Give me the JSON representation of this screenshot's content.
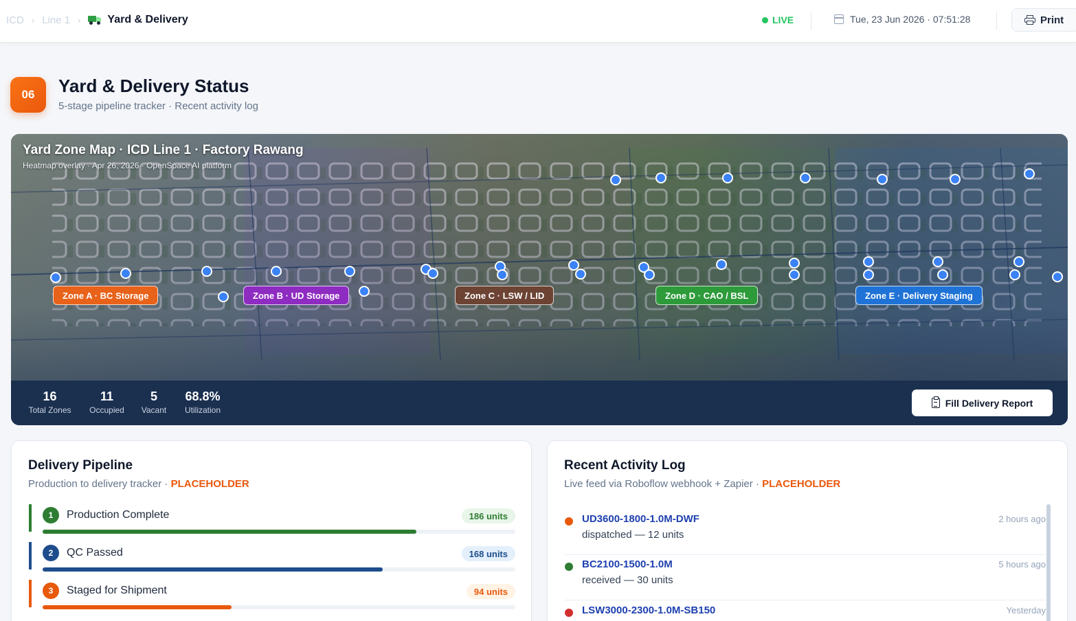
{
  "breadcrumb": {
    "items": [
      "ICD",
      "Line 1"
    ],
    "current": "Yard & Delivery"
  },
  "status": {
    "live_label": "LIVE",
    "datetime": "Tue, 23 Jun 2026 · 07:51:28",
    "print_label": "Print"
  },
  "section": {
    "badge": "06",
    "title": "Yard & Delivery Status",
    "subtitle": "5-stage pipeline tracker · Recent activity log"
  },
  "map": {
    "title": "Yard Zone Map · ICD Line 1 · Factory Rawang",
    "subtitle": "Heatmap overlay · Apr 26, 2026 · OpenSpace AI platform",
    "zones": [
      {
        "label": "Zone A · BC Storage",
        "color": "#e8621a"
      },
      {
        "label": "Zone B · UD Storage",
        "color": "#8e2bc1"
      },
      {
        "label": "Zone C · LSW / LID",
        "color": "#6d4434"
      },
      {
        "label": "Zone D · CAO / BSL",
        "color": "#2e9b3b"
      },
      {
        "label": "Zone E · Delivery Staging",
        "color": "#1f73d6"
      }
    ],
    "stats": [
      {
        "value": "16",
        "label": "Total Zones"
      },
      {
        "value": "11",
        "label": "Occupied"
      },
      {
        "value": "5",
        "label": "Vacant"
      },
      {
        "value": "68.8%",
        "label": "Utilization"
      }
    ],
    "fill_button": "Fill Delivery Report"
  },
  "pipeline": {
    "title": "Delivery Pipeline",
    "subtitle": "Production to delivery tracker · ",
    "placeholder": "PLACEHOLDER",
    "stages": [
      {
        "num": "1",
        "name": "Production Complete",
        "units": "186 units",
        "color": "#2e7d32",
        "bg": "#e8f5e9",
        "progress": 0.79
      },
      {
        "num": "2",
        "name": "QC Passed",
        "units": "168 units",
        "color": "#1e4d8c",
        "bg": "#e3f0fb",
        "progress": 0.72
      },
      {
        "num": "3",
        "name": "Staged for Shipment",
        "units": "94 units",
        "color": "#e8590c",
        "bg": "#fff3e6",
        "progress": 0.4
      }
    ]
  },
  "activity": {
    "title": "Recent Activity Log",
    "subtitle": "Live feed via Roboflow webhook + Zapier · ",
    "placeholder": "PLACEHOLDER",
    "items": [
      {
        "code": "UD3600-1800-1.0M-DWF",
        "desc": "dispatched — 12 units",
        "time": "2 hours ago",
        "color": "#e8590c"
      },
      {
        "code": "BC2100-1500-1.0M",
        "desc": "received — 30 units",
        "time": "5 hours ago",
        "color": "#2e7d32"
      },
      {
        "code": "LSW3000-2300-1.0M-SB150",
        "desc": "",
        "time": "Yesterday",
        "color": "#d32f2f"
      }
    ]
  }
}
